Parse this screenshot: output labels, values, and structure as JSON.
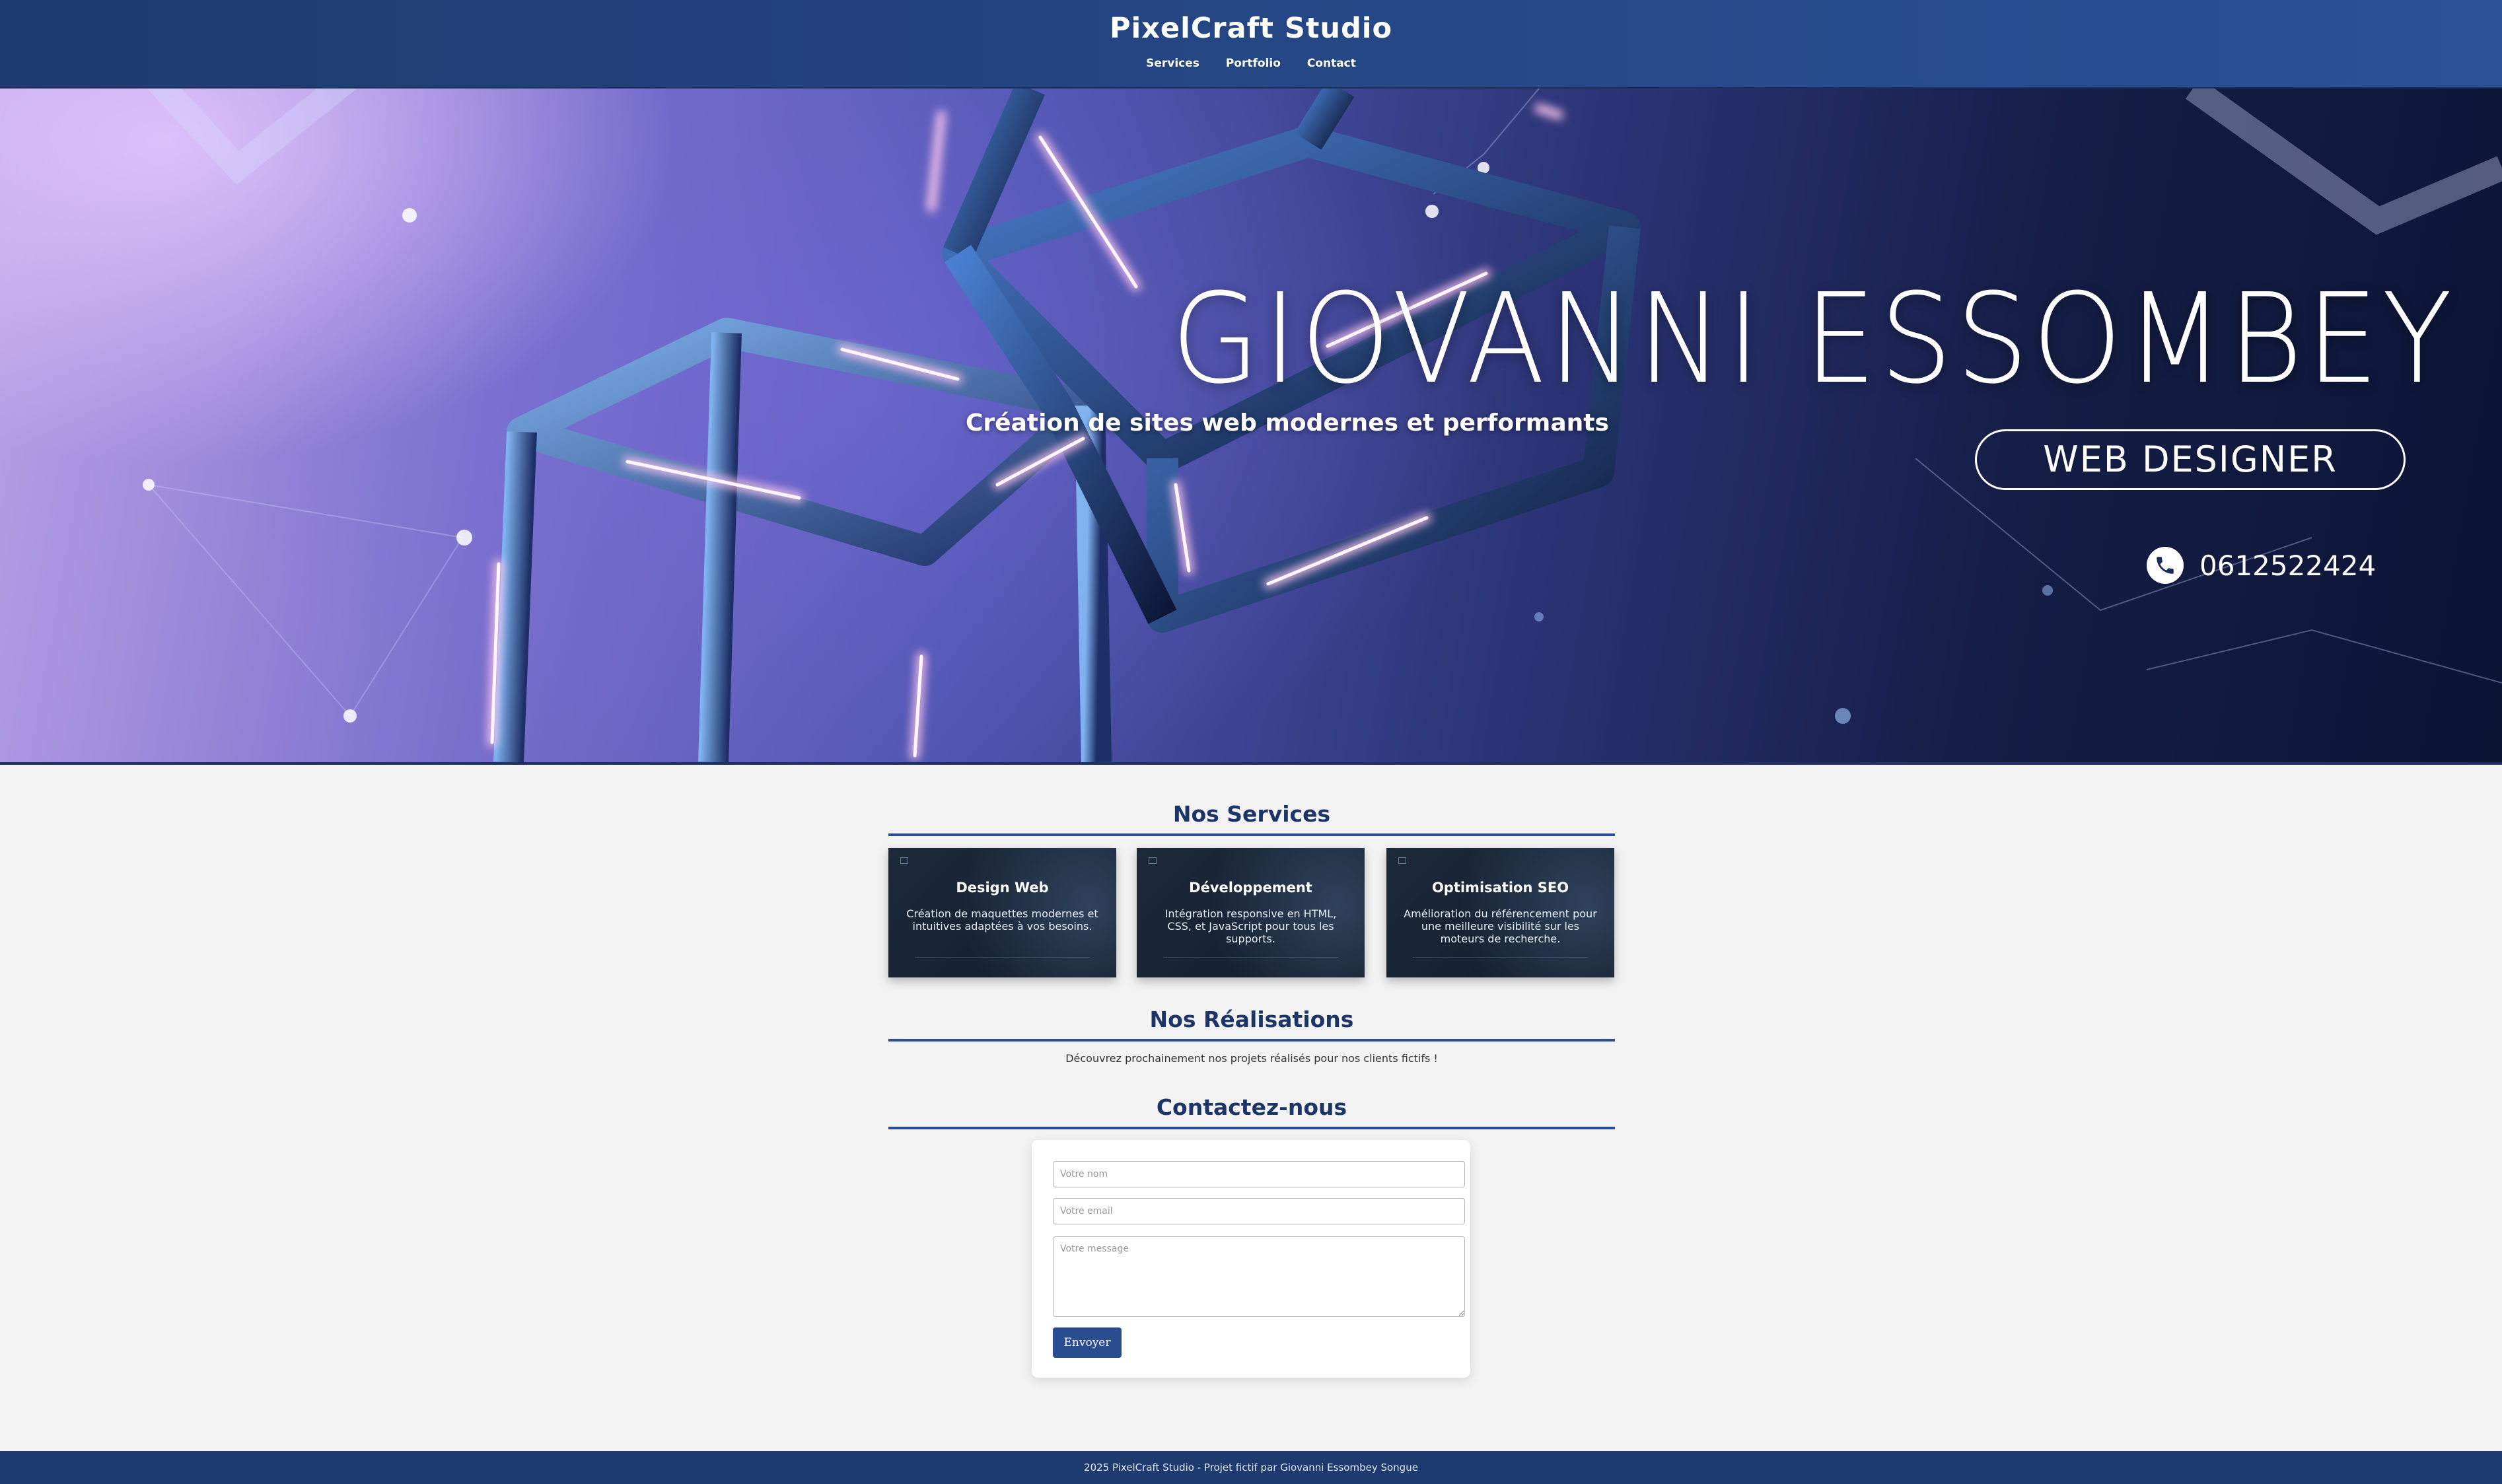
{
  "header": {
    "brand": "PixelCraft Studio",
    "nav": [
      {
        "label": "Services"
      },
      {
        "label": "Portfolio"
      },
      {
        "label": "Contact"
      }
    ]
  },
  "hero": {
    "name": "GIOVANNI ESSOMBEY",
    "tagline": "Création de sites web modernes et performants",
    "role": "WEB DESIGNER",
    "phone": "0612522424",
    "phone_icon": "phone-icon"
  },
  "services": {
    "title": "Nos Services",
    "cards": [
      {
        "title": "Design Web",
        "text": "Création de maquettes modernes et intuitives adaptées à vos besoins."
      },
      {
        "title": "Développement",
        "text": "Intégration responsive en HTML, CSS, et JavaScript pour tous les supports."
      },
      {
        "title": "Optimisation SEO",
        "text": "Amélioration du référencement pour une meilleure visibilité sur les moteurs de recherche."
      }
    ]
  },
  "portfolio": {
    "title": "Nos Réalisations",
    "text": "Découvrez prochainement nos projets réalisés pour nos clients fictifs !"
  },
  "contact": {
    "title": "Contactez-nous",
    "name_placeholder": "Votre nom",
    "email_placeholder": "Votre email",
    "message_placeholder": "Votre message",
    "submit_label": "Envoyer"
  },
  "footer": {
    "text": "2025 PixelCraft Studio - Projet fictif par Giovanni Essombey Songue"
  },
  "colors": {
    "header_bg": "#1f3a6e",
    "accent": "#2a4d8f",
    "title": "#1d3566",
    "page_bg": "#f3f3f3"
  }
}
